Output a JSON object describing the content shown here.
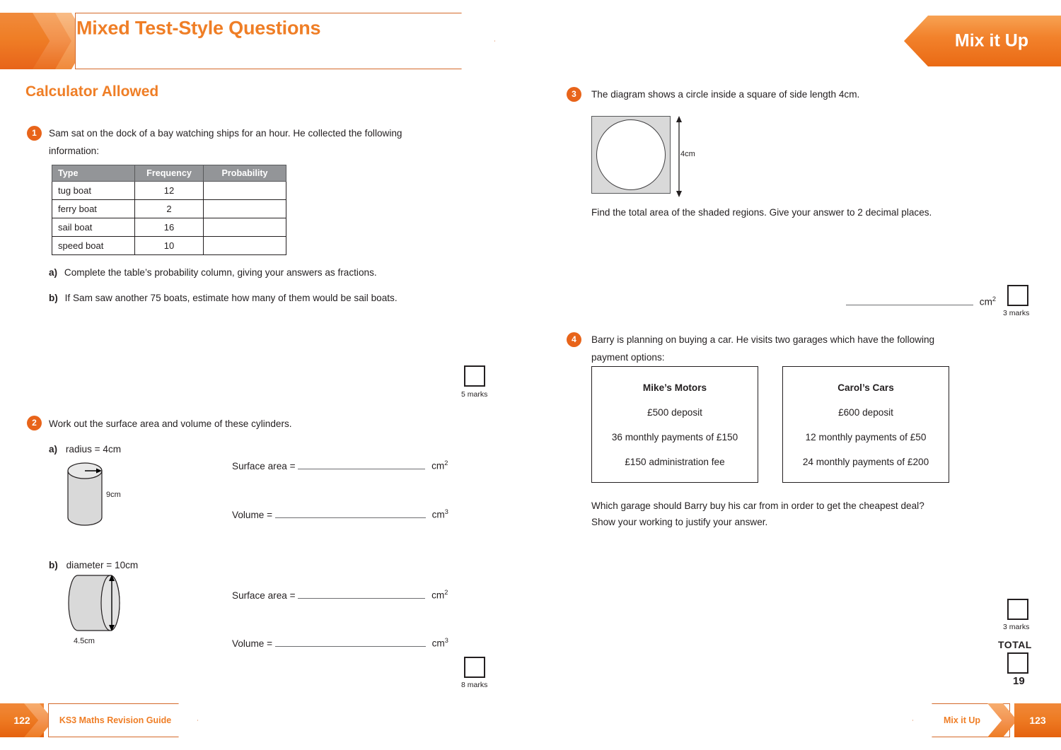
{
  "header": {
    "title": "Mixed Test-Style Questions",
    "tab_label": "Mix it Up",
    "section_heading": "Calculator Allowed"
  },
  "questions": {
    "q1": {
      "number": "1",
      "text": "Sam sat on the dock of a bay watching ships for an hour. He collected the following information:",
      "table": {
        "headers": [
          "Type",
          "Frequency",
          "Probability"
        ],
        "rows": [
          {
            "type": "tug boat",
            "frequency": "12",
            "probability": ""
          },
          {
            "type": "ferry boat",
            "frequency": "2",
            "probability": ""
          },
          {
            "type": "sail boat",
            "frequency": "16",
            "probability": ""
          },
          {
            "type": "speed boat",
            "frequency": "10",
            "probability": ""
          }
        ]
      },
      "parts": [
        {
          "letter": "a)",
          "text": "Complete the table’s probability column, giving your answers as fractions."
        },
        {
          "letter": "b)",
          "text": "If Sam saw another 75 boats, estimate how many of them would be sail boats."
        }
      ],
      "marks": "5 marks"
    },
    "q2": {
      "number": "2",
      "text": "Work out the surface area and volume of these cylinders.",
      "part_a": {
        "letter": "a)",
        "text": "radius = 4cm",
        "height_label": "9cm",
        "answers": [
          {
            "label": "Surface area =",
            "unit": "cm",
            "exponent": "2"
          },
          {
            "label": "Volume =",
            "unit": "cm",
            "exponent": "3"
          }
        ]
      },
      "part_b": {
        "letter": "b)",
        "text": "diameter = 10cm",
        "width_label": "4.5cm",
        "answers": [
          {
            "label": "Surface area =",
            "unit": "cm",
            "exponent": "2"
          },
          {
            "label": "Volume =",
            "unit": "cm",
            "exponent": "3"
          }
        ]
      },
      "marks": "8 marks"
    },
    "q3": {
      "number": "3",
      "text": "The diagram shows a circle inside a square of side length 4cm.",
      "dimension_label": "4cm",
      "prompt": "Find the total area of the shaded regions. Give your answer to 2 decimal places.",
      "answer_unit": "cm",
      "answer_exponent": "2",
      "marks": "3 marks"
    },
    "q4": {
      "number": "4",
      "text": "Barry is planning on buying a car. He visits two garages which have the following payment options:",
      "boxes": [
        {
          "title": "Mike’s Motors",
          "lines": [
            "£500 deposit",
            "36 monthly payments of £150",
            "£150 administration fee"
          ]
        },
        {
          "title": "Carol’s Cars",
          "lines": [
            "£600 deposit",
            "12 monthly payments of £50",
            "24 monthly payments of £200"
          ]
        }
      ],
      "prompt_line1": "Which garage should Barry buy his car from in order to get the cheapest deal?",
      "prompt_line2": "Show your working to justify your answer.",
      "marks": "3 marks"
    }
  },
  "total": {
    "label": "TOTAL",
    "value": "19"
  },
  "footer": {
    "left_page": "122",
    "left_text": "KS3 Maths Revision Guide",
    "right_text": "Mix it Up",
    "right_page": "123"
  },
  "colors": {
    "accent_orange": "#ef7e26",
    "dark_orange": "#e8641a",
    "table_header_gray": "#939598",
    "shape_fill": "#d9d9d9"
  }
}
